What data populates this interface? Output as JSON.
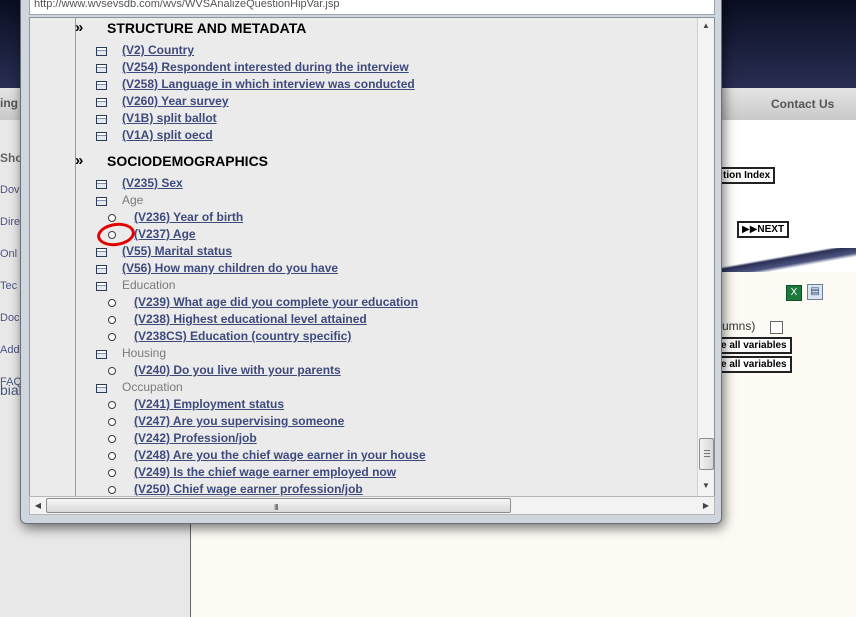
{
  "browser": {
    "address_url": "http://www.wvsevsdb.com/wvs/WVSAnalizeQuestionHipVar.jsp"
  },
  "background_page": {
    "nav_left_fragment": "ing",
    "contact": "Contact Us",
    "sidebar_fragments": [
      "Sho",
      "Dov",
      "Dire",
      "Onl",
      "Tec",
      "Doc",
      "Add",
      "FAQ",
      "bian"
    ],
    "question_index_btn": "tion Index",
    "next_btn": "NEXT",
    "columns_fragment": "umns)",
    "all_variables_1": "e all variables",
    "all_variables_2": "e all variables",
    "icons": [
      "excel-icon",
      "print-icon"
    ]
  },
  "sections": [
    {
      "title": "STRUCTURE AND METADATA",
      "rows": [
        {
          "kind": "var",
          "label": "(V2) Country"
        },
        {
          "kind": "var",
          "label": "(V254) Respondent interested during the interview"
        },
        {
          "kind": "var",
          "label": "(V258) Language in which interview was conducted"
        },
        {
          "kind": "var",
          "label": "(V260) Year survey"
        },
        {
          "kind": "var",
          "label": "(V1B) split ballot"
        },
        {
          "kind": "var",
          "label": "(V1A) split oecd"
        }
      ]
    },
    {
      "title": "SOCIODEMOGRAPHICS",
      "rows": [
        {
          "kind": "var",
          "label": "(V235) Sex"
        },
        {
          "kind": "group",
          "label": "Age"
        },
        {
          "kind": "sub",
          "label": "(V236) Year of birth"
        },
        {
          "kind": "sub",
          "label": "(V237) Age"
        },
        {
          "kind": "var",
          "label": "(V55) Marital status"
        },
        {
          "kind": "var",
          "label": "(V56) How many children do you have"
        },
        {
          "kind": "group",
          "label": "Education"
        },
        {
          "kind": "sub",
          "label": "(V239) What age did you complete your education"
        },
        {
          "kind": "sub",
          "label": "(V238) Highest educational level attained"
        },
        {
          "kind": "sub",
          "label": "(V238CS) Education (country specific)"
        },
        {
          "kind": "group",
          "label": "Housing"
        },
        {
          "kind": "sub",
          "label": "(V240) Do you live with your parents"
        },
        {
          "kind": "group",
          "label": "Occupation"
        },
        {
          "kind": "sub",
          "label": "(V241) Employment status"
        },
        {
          "kind": "sub",
          "label": "(V247) Are you supervising someone"
        },
        {
          "kind": "sub",
          "label": "(V242) Profession/job"
        },
        {
          "kind": "sub",
          "label": "(V248) Are you the chief wage earner in your house"
        },
        {
          "kind": "sub",
          "label": "(V249) Is the chief wage earner employed now"
        },
        {
          "kind": "sub",
          "label": "(V250) Chief wage earner profession/job"
        }
      ]
    }
  ],
  "ui": {
    "section_marker": "»",
    "hscroll_grip": "III",
    "annotation_color": "#e00000",
    "link_color": "#3e4a7c"
  }
}
